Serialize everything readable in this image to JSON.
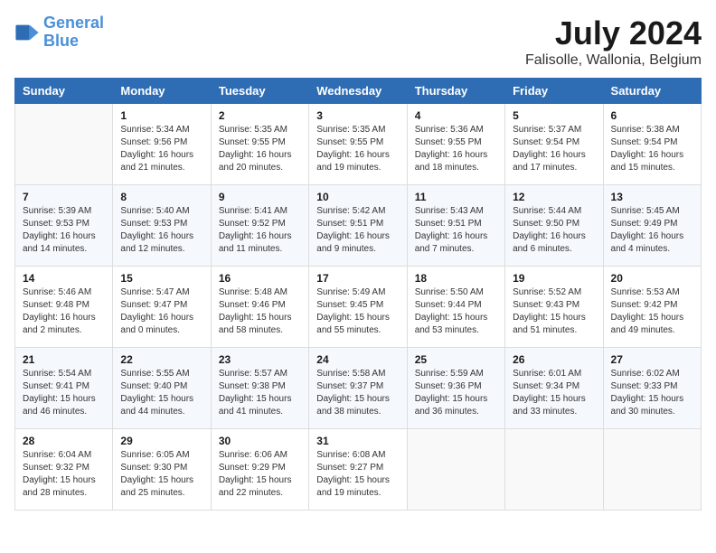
{
  "header": {
    "logo_line1": "General",
    "logo_line2": "Blue",
    "month_year": "July 2024",
    "location": "Falisolle, Wallonia, Belgium"
  },
  "weekdays": [
    "Sunday",
    "Monday",
    "Tuesday",
    "Wednesday",
    "Thursday",
    "Friday",
    "Saturday"
  ],
  "weeks": [
    [
      {
        "day": "",
        "sunrise": "",
        "sunset": "",
        "daylight": ""
      },
      {
        "day": "1",
        "sunrise": "Sunrise: 5:34 AM",
        "sunset": "Sunset: 9:56 PM",
        "daylight": "Daylight: 16 hours and 21 minutes."
      },
      {
        "day": "2",
        "sunrise": "Sunrise: 5:35 AM",
        "sunset": "Sunset: 9:55 PM",
        "daylight": "Daylight: 16 hours and 20 minutes."
      },
      {
        "day": "3",
        "sunrise": "Sunrise: 5:35 AM",
        "sunset": "Sunset: 9:55 PM",
        "daylight": "Daylight: 16 hours and 19 minutes."
      },
      {
        "day": "4",
        "sunrise": "Sunrise: 5:36 AM",
        "sunset": "Sunset: 9:55 PM",
        "daylight": "Daylight: 16 hours and 18 minutes."
      },
      {
        "day": "5",
        "sunrise": "Sunrise: 5:37 AM",
        "sunset": "Sunset: 9:54 PM",
        "daylight": "Daylight: 16 hours and 17 minutes."
      },
      {
        "day": "6",
        "sunrise": "Sunrise: 5:38 AM",
        "sunset": "Sunset: 9:54 PM",
        "daylight": "Daylight: 16 hours and 15 minutes."
      }
    ],
    [
      {
        "day": "7",
        "sunrise": "Sunrise: 5:39 AM",
        "sunset": "Sunset: 9:53 PM",
        "daylight": "Daylight: 16 hours and 14 minutes."
      },
      {
        "day": "8",
        "sunrise": "Sunrise: 5:40 AM",
        "sunset": "Sunset: 9:53 PM",
        "daylight": "Daylight: 16 hours and 12 minutes."
      },
      {
        "day": "9",
        "sunrise": "Sunrise: 5:41 AM",
        "sunset": "Sunset: 9:52 PM",
        "daylight": "Daylight: 16 hours and 11 minutes."
      },
      {
        "day": "10",
        "sunrise": "Sunrise: 5:42 AM",
        "sunset": "Sunset: 9:51 PM",
        "daylight": "Daylight: 16 hours and 9 minutes."
      },
      {
        "day": "11",
        "sunrise": "Sunrise: 5:43 AM",
        "sunset": "Sunset: 9:51 PM",
        "daylight": "Daylight: 16 hours and 7 minutes."
      },
      {
        "day": "12",
        "sunrise": "Sunrise: 5:44 AM",
        "sunset": "Sunset: 9:50 PM",
        "daylight": "Daylight: 16 hours and 6 minutes."
      },
      {
        "day": "13",
        "sunrise": "Sunrise: 5:45 AM",
        "sunset": "Sunset: 9:49 PM",
        "daylight": "Daylight: 16 hours and 4 minutes."
      }
    ],
    [
      {
        "day": "14",
        "sunrise": "Sunrise: 5:46 AM",
        "sunset": "Sunset: 9:48 PM",
        "daylight": "Daylight: 16 hours and 2 minutes."
      },
      {
        "day": "15",
        "sunrise": "Sunrise: 5:47 AM",
        "sunset": "Sunset: 9:47 PM",
        "daylight": "Daylight: 16 hours and 0 minutes."
      },
      {
        "day": "16",
        "sunrise": "Sunrise: 5:48 AM",
        "sunset": "Sunset: 9:46 PM",
        "daylight": "Daylight: 15 hours and 58 minutes."
      },
      {
        "day": "17",
        "sunrise": "Sunrise: 5:49 AM",
        "sunset": "Sunset: 9:45 PM",
        "daylight": "Daylight: 15 hours and 55 minutes."
      },
      {
        "day": "18",
        "sunrise": "Sunrise: 5:50 AM",
        "sunset": "Sunset: 9:44 PM",
        "daylight": "Daylight: 15 hours and 53 minutes."
      },
      {
        "day": "19",
        "sunrise": "Sunrise: 5:52 AM",
        "sunset": "Sunset: 9:43 PM",
        "daylight": "Daylight: 15 hours and 51 minutes."
      },
      {
        "day": "20",
        "sunrise": "Sunrise: 5:53 AM",
        "sunset": "Sunset: 9:42 PM",
        "daylight": "Daylight: 15 hours and 49 minutes."
      }
    ],
    [
      {
        "day": "21",
        "sunrise": "Sunrise: 5:54 AM",
        "sunset": "Sunset: 9:41 PM",
        "daylight": "Daylight: 15 hours and 46 minutes."
      },
      {
        "day": "22",
        "sunrise": "Sunrise: 5:55 AM",
        "sunset": "Sunset: 9:40 PM",
        "daylight": "Daylight: 15 hours and 44 minutes."
      },
      {
        "day": "23",
        "sunrise": "Sunrise: 5:57 AM",
        "sunset": "Sunset: 9:38 PM",
        "daylight": "Daylight: 15 hours and 41 minutes."
      },
      {
        "day": "24",
        "sunrise": "Sunrise: 5:58 AM",
        "sunset": "Sunset: 9:37 PM",
        "daylight": "Daylight: 15 hours and 38 minutes."
      },
      {
        "day": "25",
        "sunrise": "Sunrise: 5:59 AM",
        "sunset": "Sunset: 9:36 PM",
        "daylight": "Daylight: 15 hours and 36 minutes."
      },
      {
        "day": "26",
        "sunrise": "Sunrise: 6:01 AM",
        "sunset": "Sunset: 9:34 PM",
        "daylight": "Daylight: 15 hours and 33 minutes."
      },
      {
        "day": "27",
        "sunrise": "Sunrise: 6:02 AM",
        "sunset": "Sunset: 9:33 PM",
        "daylight": "Daylight: 15 hours and 30 minutes."
      }
    ],
    [
      {
        "day": "28",
        "sunrise": "Sunrise: 6:04 AM",
        "sunset": "Sunset: 9:32 PM",
        "daylight": "Daylight: 15 hours and 28 minutes."
      },
      {
        "day": "29",
        "sunrise": "Sunrise: 6:05 AM",
        "sunset": "Sunset: 9:30 PM",
        "daylight": "Daylight: 15 hours and 25 minutes."
      },
      {
        "day": "30",
        "sunrise": "Sunrise: 6:06 AM",
        "sunset": "Sunset: 9:29 PM",
        "daylight": "Daylight: 15 hours and 22 minutes."
      },
      {
        "day": "31",
        "sunrise": "Sunrise: 6:08 AM",
        "sunset": "Sunset: 9:27 PM",
        "daylight": "Daylight: 15 hours and 19 minutes."
      },
      {
        "day": "",
        "sunrise": "",
        "sunset": "",
        "daylight": ""
      },
      {
        "day": "",
        "sunrise": "",
        "sunset": "",
        "daylight": ""
      },
      {
        "day": "",
        "sunrise": "",
        "sunset": "",
        "daylight": ""
      }
    ]
  ]
}
